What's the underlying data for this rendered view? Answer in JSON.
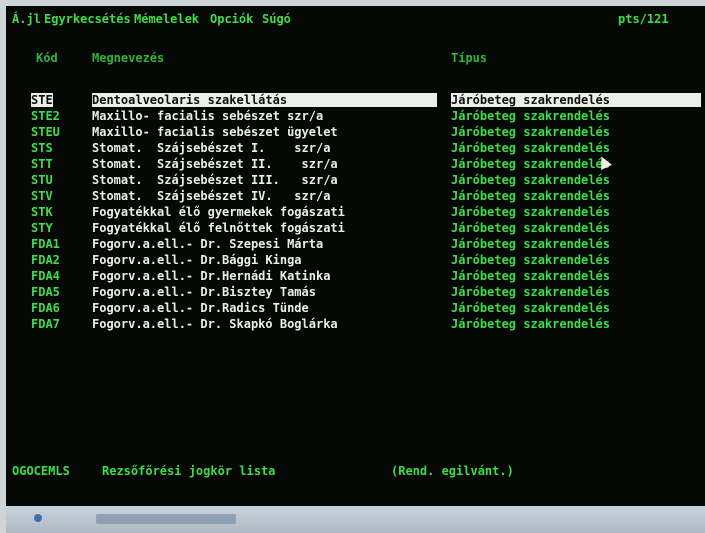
{
  "menubar": {
    "items": [
      "Á.jl",
      "Egyrkecsétés",
      "Mémelelek",
      "Opciók",
      "Súgó"
    ],
    "right": "pts/121"
  },
  "columns": {
    "code": "Kód",
    "name": "Megnevezés",
    "type": "Típus"
  },
  "rows": [
    {
      "code": "STE",
      "name": "Dentoalveolaris szakellátás",
      "type": "Járóbeteg szakrendelés",
      "selected": true
    },
    {
      "code": "STE2",
      "name": "Maxillo- facialis sebészet szr/a",
      "type": "Járóbeteg szakrendelés"
    },
    {
      "code": "STEU",
      "name": "Maxillo- facialis sebészet ügyelet",
      "type": "Járóbeteg szakrendelés"
    },
    {
      "code": "STS",
      "name": "Stomat.  Szájsebészet I.    szr/a",
      "type": "Járóbeteg szakrendelés"
    },
    {
      "code": "STT",
      "name": "Stomat.  Szájsebészet II.    szr/a",
      "type": "Járóbeteg szakrendelés"
    },
    {
      "code": "STU",
      "name": "Stomat.  Szájsebészet III.   szr/a",
      "type": "Járóbeteg szakrendelés"
    },
    {
      "code": "STV",
      "name": "Stomat.  Szájsebészet IV.   szr/a",
      "type": "Járóbeteg szakrendelés"
    },
    {
      "code": "STK",
      "name": "Fogyatékkal élő gyermekek fogászati",
      "type": "Járóbeteg szakrendelés"
    },
    {
      "code": "STY",
      "name": "Fogyatékkal élő felnőttek fogászati",
      "type": "Járóbeteg szakrendelés"
    },
    {
      "code": "FDA1",
      "name": "Fogorv.a.ell.- Dr. Szepesi Márta",
      "type": "Járóbeteg szakrendelés"
    },
    {
      "code": "FDA2",
      "name": "Fogorv.a.ell.- Dr.Bággi Kinga",
      "type": "Járóbeteg szakrendelés"
    },
    {
      "code": "FDA4",
      "name": "Fogorv.a.ell.- Dr.Hernádi Katinka",
      "type": "Járóbeteg szakrendelés"
    },
    {
      "code": "FDA5",
      "name": "Fogorv.a.ell.- Dr.Bisztey Tamás",
      "type": "Járóbeteg szakrendelés"
    },
    {
      "code": "FDA6",
      "name": "Fogorv.a.ell.- Dr.Radics Tünde",
      "type": "Járóbeteg szakrendelés"
    },
    {
      "code": "FDA7",
      "name": "Fogorv.a.ell.- Dr. Skapkó Boglárka",
      "type": "Járóbeteg szakrendelés"
    }
  ],
  "status": {
    "code": "OGOCEMLS",
    "text": "Rezsőfőrési jogkör lista",
    "hint": "(Rend. egilvánt.)"
  },
  "colors": {
    "terminal_bg": "#050805",
    "green": "#3ddf47",
    "white": "#e9f1e6"
  }
}
